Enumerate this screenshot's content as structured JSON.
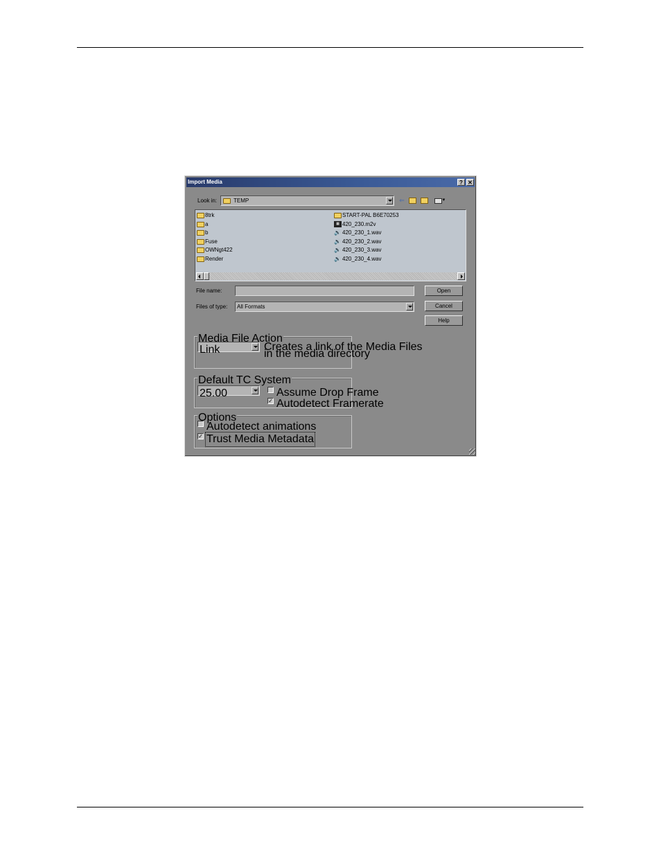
{
  "dialog": {
    "title": "Import Media",
    "help_label": "?",
    "close_label": "✕",
    "look_in_label": "Look in:",
    "look_in_value": "TEMP",
    "toolbar": {
      "back_icon": "back-arrow-icon",
      "up_icon": "up-folder-icon",
      "new_folder_icon": "new-folder-icon",
      "views_icon": "views-menu-icon"
    },
    "files_left": [
      {
        "name": "8trk",
        "type": "folder"
      },
      {
        "name": "a",
        "type": "folder"
      },
      {
        "name": "b",
        "type": "folder"
      },
      {
        "name": "Fuse",
        "type": "folder"
      },
      {
        "name": "OWNgt422",
        "type": "folder"
      },
      {
        "name": "Render",
        "type": "folder"
      }
    ],
    "files_right": [
      {
        "name": "START-PAL B6E70253",
        "type": "folder"
      },
      {
        "name": "420_230.m2v",
        "type": "video"
      },
      {
        "name": "420_230_1.wav",
        "type": "audio"
      },
      {
        "name": "420_230_2.wav",
        "type": "audio"
      },
      {
        "name": "420_230_3.wav",
        "type": "audio"
      },
      {
        "name": "420_230_4.wav",
        "type": "audio"
      }
    ],
    "file_name_label": "File name:",
    "file_name_value": "",
    "files_of_type_label": "Files of type:",
    "files_of_type_value": "All Formats",
    "open_label": "Open",
    "cancel_label": "Cancel",
    "help_button_label": "Help",
    "media_file_action": {
      "title": "Media File Action",
      "value": "Link",
      "description_line1": "Creates a link of the Media Files",
      "description_line2": "in the media directory"
    },
    "default_tc_system": {
      "title": "Default TC System",
      "value": "25.00",
      "assume_drop_frame_label": "Assume Drop Frame",
      "assume_drop_frame_checked": false,
      "autodetect_framerate_label": "Autodetect Framerate",
      "autodetect_framerate_checked": true
    },
    "options": {
      "title": "Options",
      "autodetect_animations_label": "Autodetect animations",
      "autodetect_animations_checked": false,
      "trust_media_metadata_label": "Trust Media Metadata",
      "trust_media_metadata_checked": true
    },
    "check_mark": "✓"
  }
}
